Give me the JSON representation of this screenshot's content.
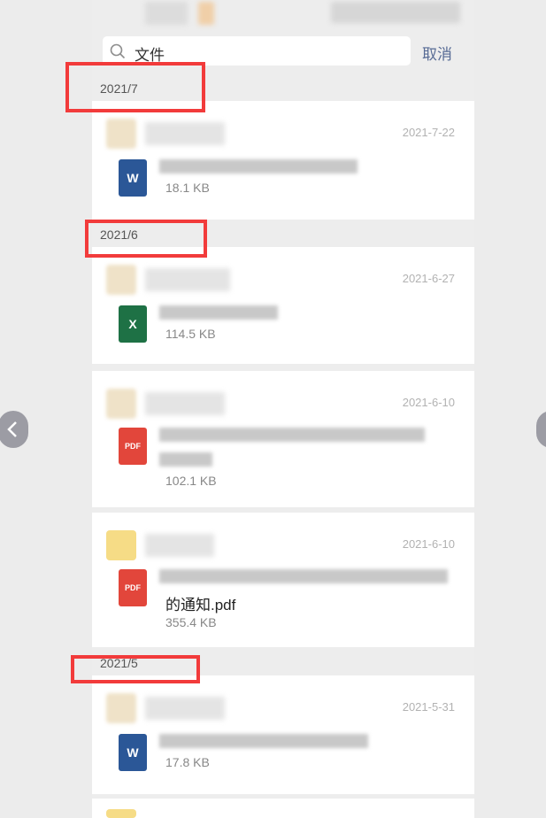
{
  "search": {
    "query": "文件",
    "cancel_label": "取消"
  },
  "groups": [
    {
      "month": "2021/7"
    },
    {
      "month": "2021/6"
    },
    {
      "month": "2021/5"
    }
  ],
  "files": [
    {
      "date": "2021-7-22",
      "type": "W",
      "name": "",
      "size": "18.1 KB"
    },
    {
      "date": "2021-6-27",
      "type": "X",
      "name": "",
      "size": "114.5 KB"
    },
    {
      "date": "2021-6-10",
      "type": "PDF",
      "name": "",
      "size": "102.1 KB"
    },
    {
      "date": "2021-6-10",
      "type": "PDF",
      "name": "的通知.pdf",
      "size": "355.4 KB"
    },
    {
      "date": "2021-5-31",
      "type": "W",
      "name": "",
      "size": "17.8 KB"
    }
  ],
  "colors": {
    "highlight": "#f23b3b",
    "link": "#576b95",
    "word": "#2b5797",
    "excel": "#1e7145",
    "pdf": "#e2463b"
  }
}
